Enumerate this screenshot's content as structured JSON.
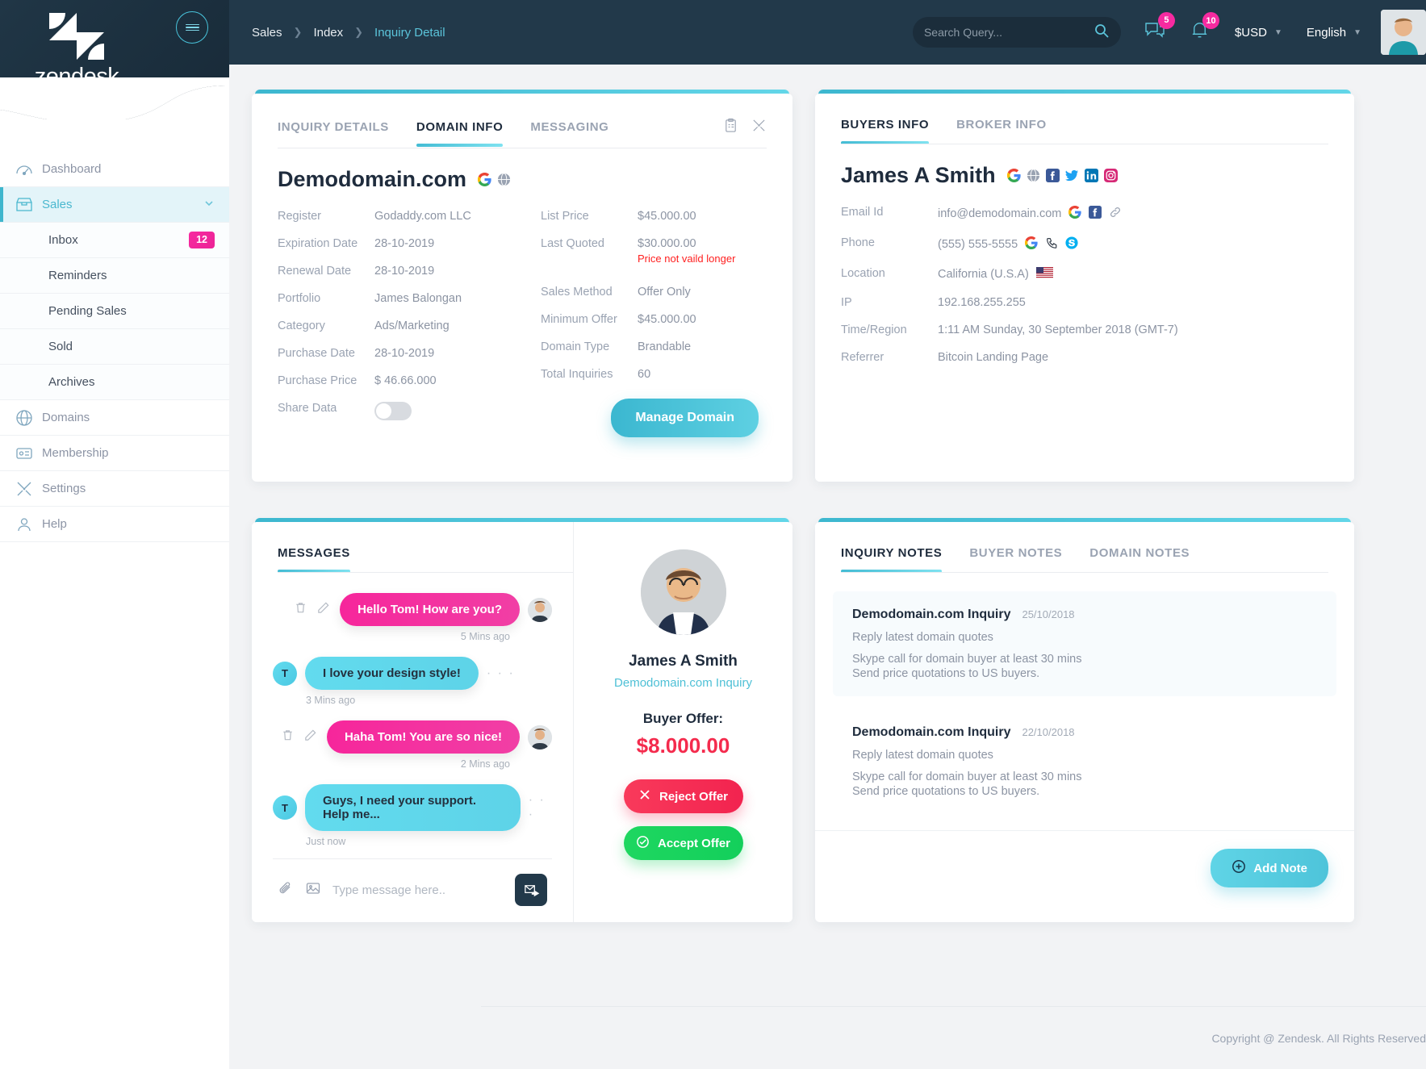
{
  "brand": {
    "name": "zendesk",
    "logo_icon": "zendesk-logo-icon",
    "menu_icon": "hamburger-menu-icon"
  },
  "sidebar": {
    "items": [
      {
        "label": "Dashboard",
        "icon": "dashboard-gauge-icon",
        "active": false
      },
      {
        "label": "Sales",
        "icon": "sales-box-icon",
        "active": true,
        "chevron": "chevron-down-icon"
      },
      {
        "label": "Domains",
        "icon": "globe-www-icon",
        "active": false
      },
      {
        "label": "Membership",
        "icon": "membership-card-icon",
        "active": false
      },
      {
        "label": "Settings",
        "icon": "tools-settings-icon",
        "active": false
      },
      {
        "label": "Help",
        "icon": "help-person-icon",
        "active": false
      }
    ],
    "sub_items": [
      {
        "label": "Inbox",
        "badge": "12"
      },
      {
        "label": "Reminders",
        "badge": ""
      },
      {
        "label": "Pending Sales",
        "badge": ""
      },
      {
        "label": "Sold",
        "badge": ""
      },
      {
        "label": "Archives",
        "badge": ""
      }
    ]
  },
  "header": {
    "breadcrumb": {
      "root": "Sales",
      "mid": "Index",
      "current": "Inquiry Detail"
    },
    "search": {
      "placeholder": "Search Query...",
      "value": "",
      "icon": "search-icon"
    },
    "messages_icon": "chat-bubbles-icon",
    "messages_count": "5",
    "notifications_icon": "bell-icon",
    "notifications_count": "10",
    "currency": "$USD",
    "language": "English",
    "avatar_icon": "user-avatar-photo"
  },
  "domain_card": {
    "tabs": [
      {
        "label": "INQUIRY DETAILS",
        "active": false
      },
      {
        "label": "DOMAIN INFO",
        "active": true
      },
      {
        "label": "MESSAGING",
        "active": false
      }
    ],
    "icons": [
      "clipboard-icon",
      "tools-icon"
    ],
    "title": "Demodomain.com",
    "title_icons": [
      "google-icon",
      "globe-icon"
    ],
    "left_fields": [
      {
        "label": "Register",
        "value": "Godaddy.com LLC"
      },
      {
        "label": "Expiration Date",
        "value": "28-10-2019"
      },
      {
        "label": "Renewal Date",
        "value": "28-10-2019"
      },
      {
        "label": "Portfolio",
        "value": "James Balongan"
      },
      {
        "label": "Category",
        "value": "Ads/Marketing"
      },
      {
        "label": "Purchase Date",
        "value": "28-10-2019"
      },
      {
        "label": "Purchase Price",
        "value": "$ 46.66.000"
      }
    ],
    "share_data_label": "Share Data",
    "share_data_on": false,
    "right_fields": [
      {
        "label": "List Price",
        "value": "$45.000.00",
        "warn": ""
      },
      {
        "label": "Last Quoted",
        "value": "$30.000.00",
        "warn": "Price not vaild longer"
      },
      {
        "label": "Sales Method",
        "value": "Offer Only",
        "warn": ""
      },
      {
        "label": "Minimum Offer",
        "value": "$45.000.00",
        "warn": ""
      },
      {
        "label": "Domain Type",
        "value": "Brandable",
        "warn": ""
      },
      {
        "label": "Total Inquiries",
        "value": "60",
        "warn": ""
      }
    ],
    "manage_button": "Manage Domain"
  },
  "buyers_card": {
    "tabs": [
      {
        "label": "BUYERS INFO",
        "active": true
      },
      {
        "label": "BROKER INFO",
        "active": false
      }
    ],
    "name": "James A Smith",
    "name_icons": [
      "google-icon",
      "globe-icon",
      "facebook-icon",
      "twitter-icon",
      "linkedin-icon",
      "instagram-icon"
    ],
    "fields": [
      {
        "label": "Email Id",
        "value": "info@demodomain.com",
        "icons": [
          "google-icon",
          "facebook-icon",
          "link-icon"
        ]
      },
      {
        "label": "Phone",
        "value": "(555) 555-5555",
        "icons": [
          "google-icon",
          "phone-call-icon",
          "skype-icon"
        ]
      },
      {
        "label": "Location",
        "value": "California (U.S.A)",
        "icons": [
          "usa-flag-icon"
        ]
      },
      {
        "label": "IP",
        "value": "192.168.255.255",
        "icons": []
      },
      {
        "label": "Time/Region",
        "value": "1:11 AM  Sunday, 30 September 2018 (GMT-7)",
        "icons": []
      },
      {
        "label": "Referrer",
        "value": "Bitcoin Landing Page",
        "icons": []
      }
    ]
  },
  "messages_card": {
    "title": "MESSAGES",
    "messages": [
      {
        "text": "Hello Tom! How are you?",
        "time": "5 Mins ago",
        "side": "out",
        "avatar": "user-photo-avatar",
        "actions": [
          "trash-icon",
          "pencil-icon"
        ]
      },
      {
        "text": "I love your design style!",
        "time": "3 Mins ago",
        "side": "in",
        "avatar_letter": "T",
        "dots": "· · ·"
      },
      {
        "text": "Haha Tom! You are so nice!",
        "time": "2 Mins ago",
        "side": "out",
        "avatar": "user-photo-avatar",
        "actions": [
          "trash-icon",
          "pencil-icon"
        ]
      },
      {
        "text": "Guys, I need your support. Help me...",
        "time": "Just now",
        "side": "in",
        "avatar_letter": "T",
        "dots": "· · ·"
      }
    ],
    "compose": {
      "attach_icon": "paperclip-icon",
      "image_icon": "image-icon",
      "placeholder": "Type message here..",
      "value": "",
      "send_icon": "send-message-icon"
    },
    "offer": {
      "avatar_icon": "buyer-photo-avatar",
      "name": "James A Smith",
      "link": "Demodomain.com Inquiry",
      "offer_label": "Buyer Offer:",
      "offer_amount": "$8.000.00",
      "reject_label": "Reject Offer",
      "reject_icon": "close-x-icon",
      "accept_label": "Accept Offer",
      "accept_icon": "check-circle-icon"
    }
  },
  "notes_card": {
    "tabs": [
      {
        "label": "INQUIRY NOTES",
        "active": true
      },
      {
        "label": "BUYER NOTES",
        "active": false
      },
      {
        "label": "DOMAIN NOTES",
        "active": false
      }
    ],
    "notes": [
      {
        "title": "Demodomain.com Inquiry",
        "date": "25/10/2018",
        "lines": [
          "Reply latest domain quotes",
          "Skype call for domain buyer at least 30 mins",
          "Send price quotations to US buyers."
        ]
      },
      {
        "title": "Demodomain.com Inquiry",
        "date": "22/10/2018",
        "lines": [
          "Reply latest domain quotes",
          "Skype call for domain buyer at least 30 mins",
          "Send price quotations to US buyers."
        ]
      }
    ],
    "add_label": "Add Note",
    "add_icon": "plus-circle-icon"
  },
  "footer": {
    "copyright": "Copyright @ Zendesk. All Rights Reserved"
  },
  "colors": {
    "accent_cyan": "#3fb6cd",
    "accent_pink": "#f72aa0",
    "dark": "#22394a",
    "danger": "#f42b4d",
    "success": "#13cf5b"
  }
}
